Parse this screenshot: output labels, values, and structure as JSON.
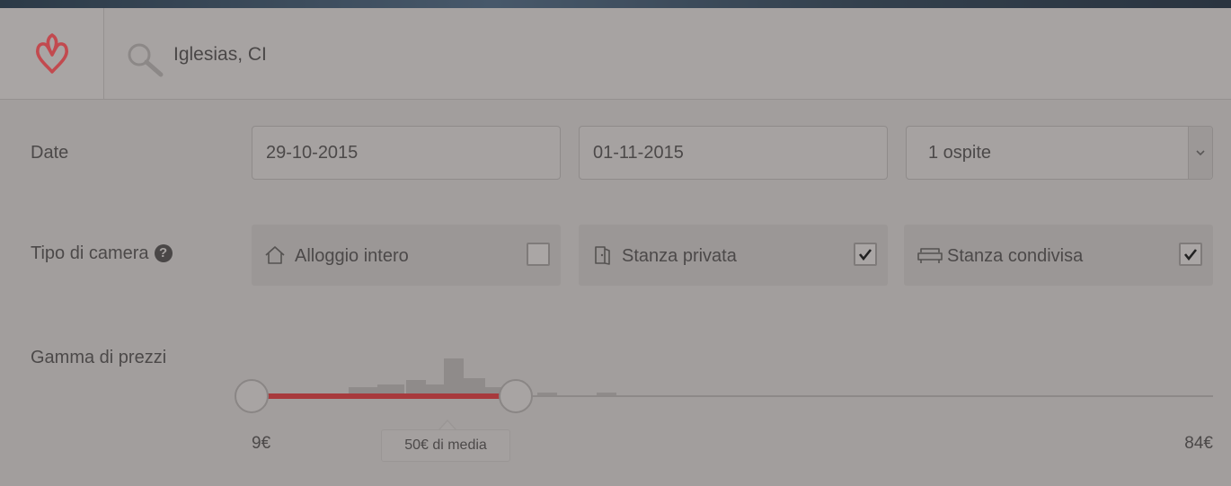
{
  "search": {
    "location": "Iglesias, CI"
  },
  "dates": {
    "label": "Date",
    "checkin": "29-10-2015",
    "checkout": "01-11-2015",
    "guests": "1 ospite"
  },
  "room_type": {
    "label": "Tipo di camera",
    "help_glyph": "?",
    "options": [
      {
        "label": "Alloggio intero",
        "icon": "house-icon",
        "checked": false
      },
      {
        "label": "Stanza privata",
        "icon": "door-icon",
        "checked": true
      },
      {
        "label": "Stanza condivisa",
        "icon": "sofa-icon",
        "checked": true
      }
    ]
  },
  "price": {
    "label": "Gamma di prezzi",
    "min": "9€",
    "max": "84€",
    "average_label": "50€ di media",
    "range_min_value": 9,
    "range_max_value": 84,
    "selected_min": 9,
    "selected_max": 50
  },
  "colors": {
    "brand": "#c24a4f",
    "range_fill": "#a83a3d"
  }
}
